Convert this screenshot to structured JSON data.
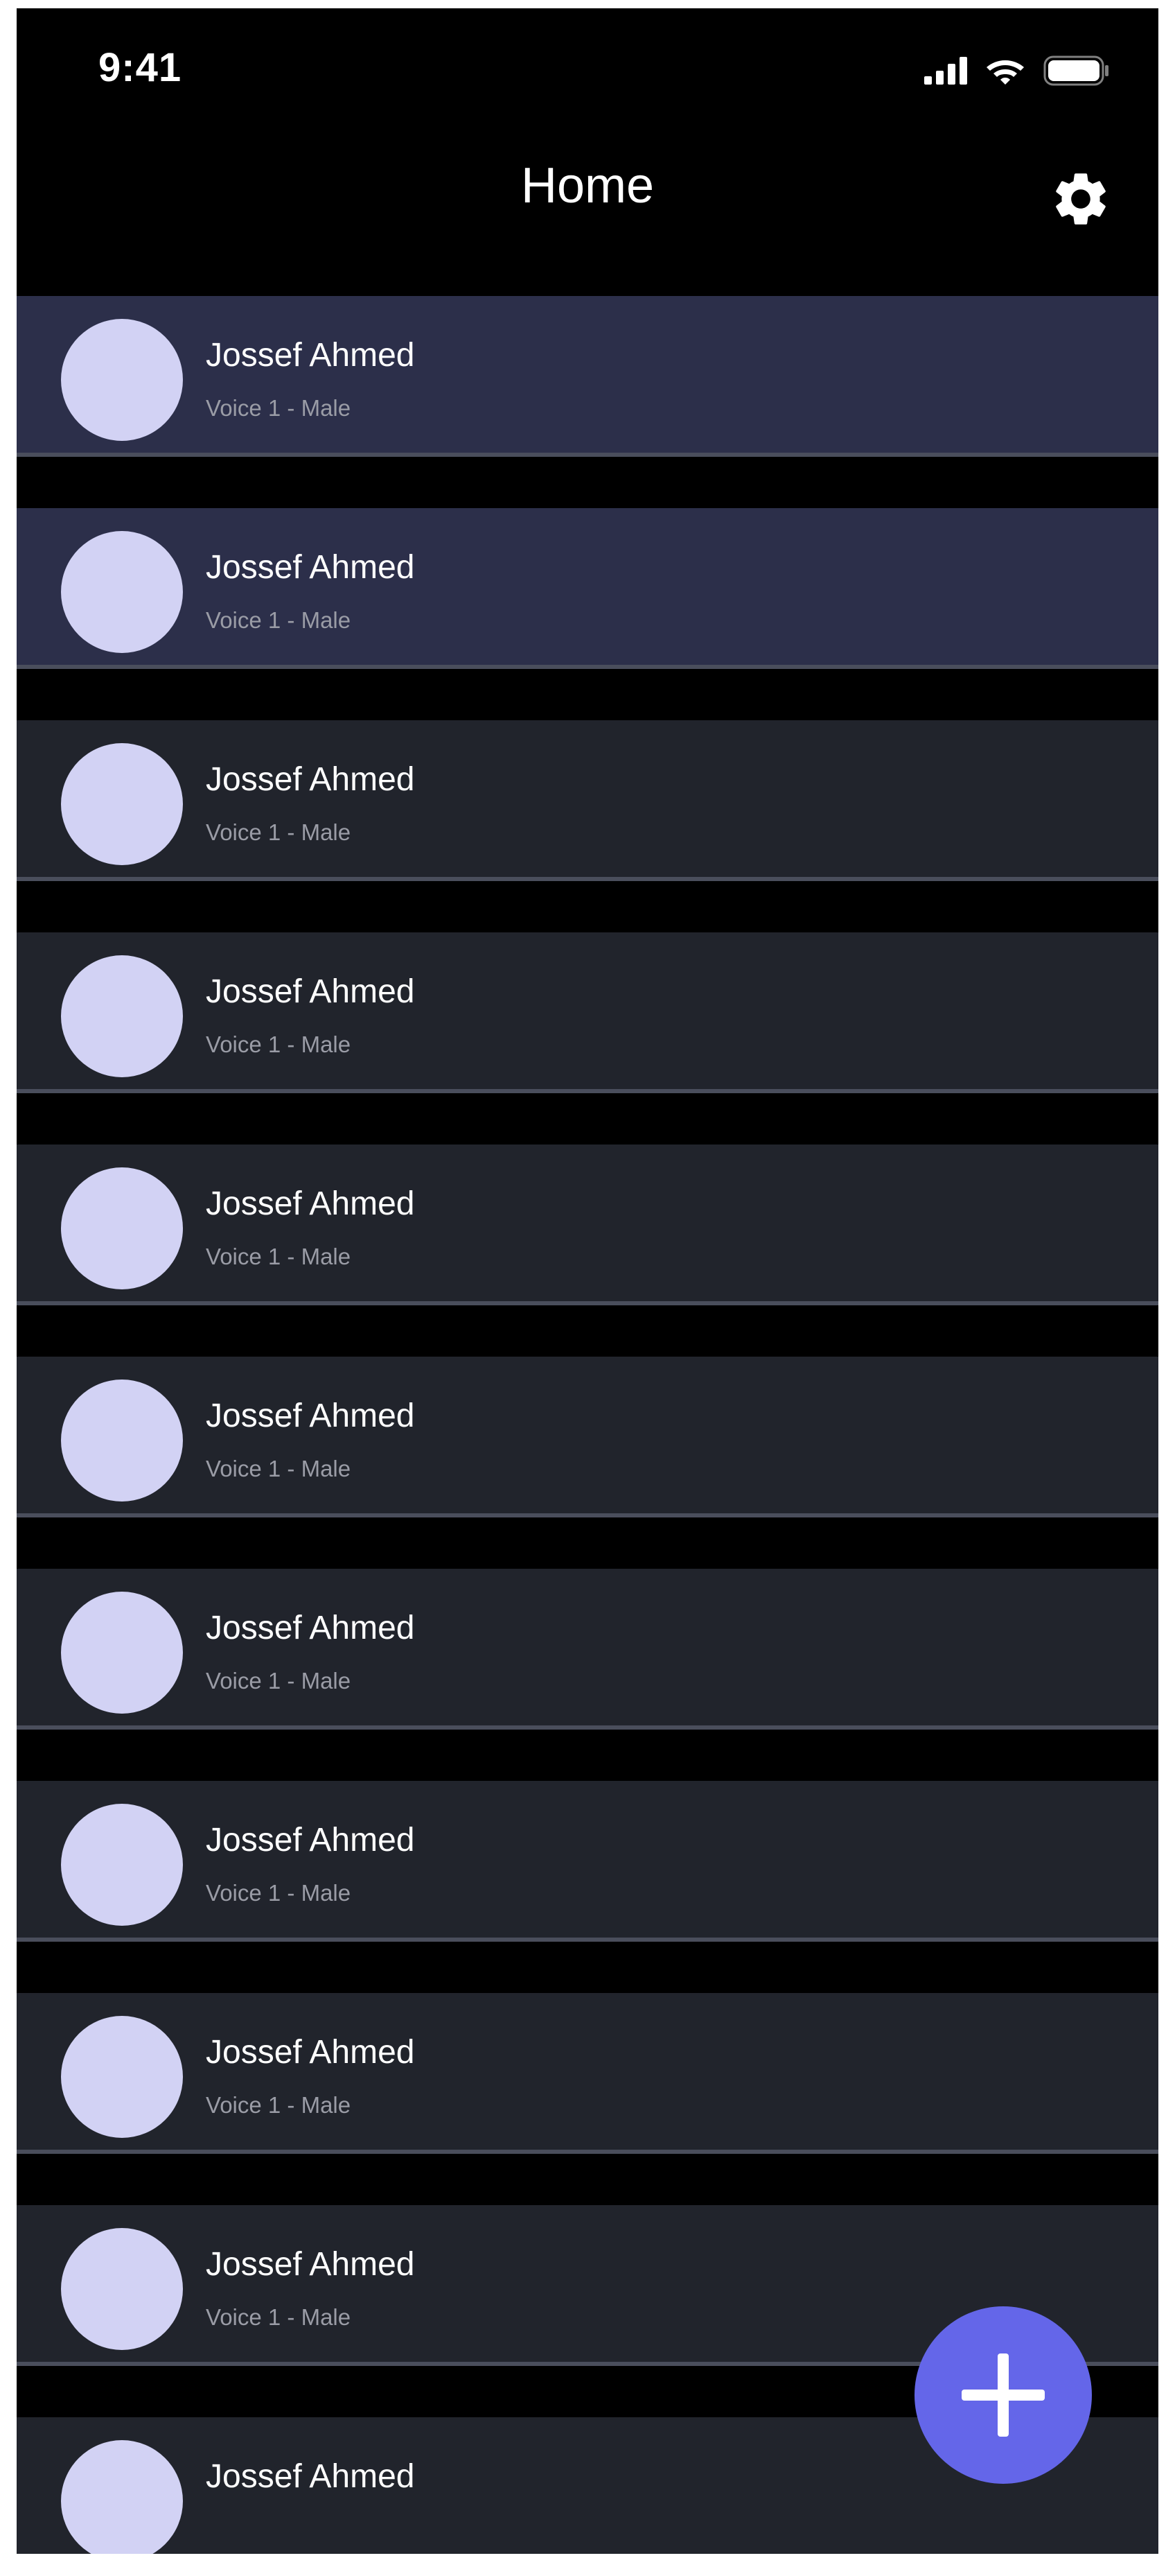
{
  "status_bar": {
    "time": "9:41",
    "icons": [
      "signal-icon",
      "wifi-icon",
      "battery-icon"
    ]
  },
  "header": {
    "title": "Home",
    "settings_icon": "gear-icon"
  },
  "contacts": [
    {
      "name": "Jossef Ahmed",
      "subtitle": "Voice 1 - Male",
      "highlighted": true
    },
    {
      "name": "Jossef Ahmed",
      "subtitle": "Voice 1 - Male",
      "highlighted": true
    },
    {
      "name": "Jossef Ahmed",
      "subtitle": "Voice 1 - Male",
      "highlighted": false
    },
    {
      "name": "Jossef Ahmed",
      "subtitle": "Voice 1 - Male",
      "highlighted": false
    },
    {
      "name": "Jossef Ahmed",
      "subtitle": "Voice 1 - Male",
      "highlighted": false
    },
    {
      "name": "Jossef Ahmed",
      "subtitle": "Voice 1 - Male",
      "highlighted": false
    },
    {
      "name": "Jossef Ahmed",
      "subtitle": "Voice 1 - Male",
      "highlighted": false
    },
    {
      "name": "Jossef Ahmed",
      "subtitle": "Voice 1 - Male",
      "highlighted": false
    },
    {
      "name": "Jossef Ahmed",
      "subtitle": "Voice 1 - Male",
      "highlighted": false
    },
    {
      "name": "Jossef Ahmed",
      "subtitle": "Voice 1 - Male",
      "highlighted": false
    },
    {
      "name": "Jossef Ahmed",
      "subtitle": "",
      "highlighted": false
    }
  ],
  "fab": {
    "icon": "plus-icon"
  },
  "colors": {
    "background": "#000000",
    "row": "#21242c",
    "row_highlighted": "#2c2f4a",
    "row_divider": "#4a4e5c",
    "avatar": "#d2d2f4",
    "accent": "#6466e9"
  }
}
